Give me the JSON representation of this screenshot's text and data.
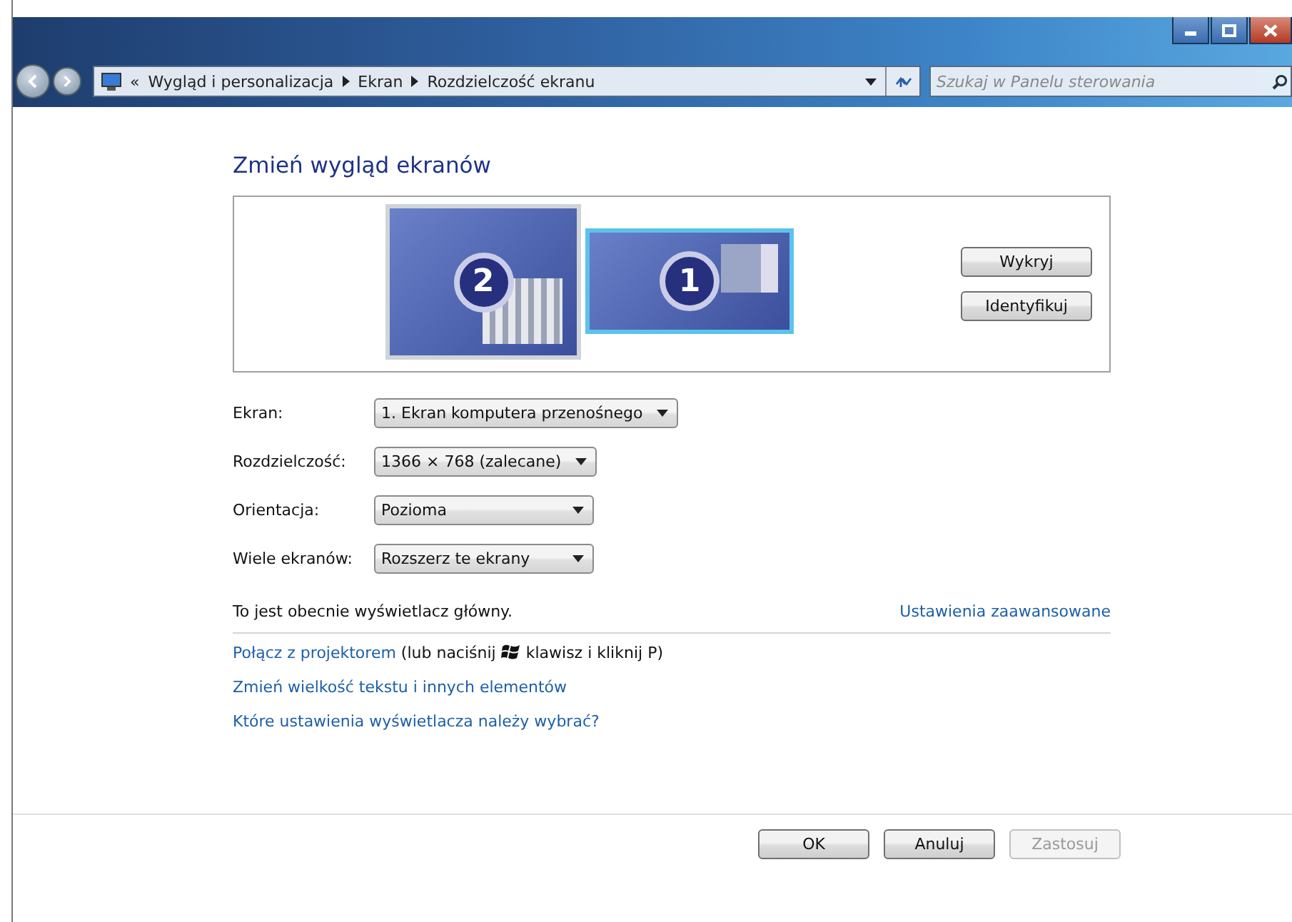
{
  "address_bar": {
    "overflow": "«",
    "breadcrumbs": [
      "Wygląd i personalizacja",
      "Ekran",
      "Rozdzielczość ekranu"
    ],
    "search_placeholder": "Szukaj w Panelu sterowania"
  },
  "heading": "Zmień wygląd ekranów",
  "monitors": [
    {
      "number": "2",
      "selected": false
    },
    {
      "number": "1",
      "selected": true
    }
  ],
  "monitor_buttons": [
    "Wykryj",
    "Identyfikuj"
  ],
  "settings": [
    {
      "label": "Ekran:",
      "value": "1. Ekran komputera przenośnego"
    },
    {
      "label": "Rozdzielczość:",
      "value": "1366 × 768 (zalecane)"
    },
    {
      "label": "Orientacja:",
      "value": "Pozioma"
    },
    {
      "label": "Wiele ekranów:",
      "value": "Rozszerz te ekrany"
    }
  ],
  "status_text": "To jest obecnie wyświetlacz główny.",
  "advanced_link": "Ustawienia zaawansowane",
  "projector": {
    "link": "Połącz z projektorem",
    "before_icon": "(lub naciśnij",
    "after_icon": "klawisz i kliknij P)"
  },
  "links": [
    "Zmień wielkość tekstu i innych elementów",
    "Które ustawienia wyświetlacza należy wybrać?"
  ],
  "buttons": [
    {
      "label": "OK",
      "disabled": false
    },
    {
      "label": "Anuluj",
      "disabled": false
    },
    {
      "label": "Zastosuj",
      "disabled": true
    }
  ]
}
